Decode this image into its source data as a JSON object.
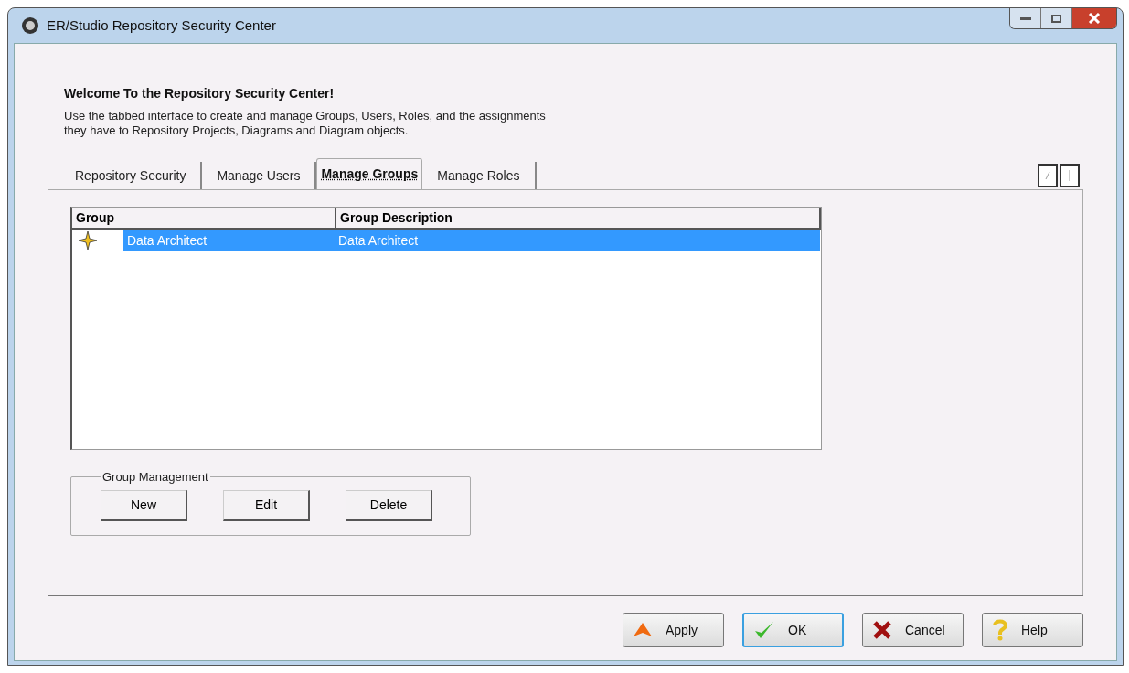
{
  "window": {
    "title": "ER/Studio Repository Security Center"
  },
  "welcome": {
    "heading": "Welcome To the Repository Security Center!",
    "text": "Use the tabbed interface to create and manage Groups, Users, Roles, and the assignments\nthey have to Repository Projects, Diagrams and Diagram objects."
  },
  "tabs": [
    {
      "label": "Repository Security",
      "selected": false
    },
    {
      "label": "Manage Users",
      "selected": false
    },
    {
      "label": "Manage Groups",
      "selected": true
    },
    {
      "label": "Manage Roles",
      "selected": false
    }
  ],
  "table": {
    "columns": [
      "Group",
      "Group Description"
    ],
    "rows": [
      {
        "cells": [
          "Data Architect",
          "Data Architect"
        ],
        "selected": true
      }
    ]
  },
  "group_management": {
    "title": "Group Management",
    "buttons": [
      "New",
      "Edit",
      "Delete"
    ]
  },
  "footer_buttons": [
    {
      "label": "Apply",
      "kind": "apply",
      "default": false
    },
    {
      "label": "OK",
      "kind": "ok",
      "default": true
    },
    {
      "label": "Cancel",
      "kind": "cancel",
      "default": false
    },
    {
      "label": "Help",
      "kind": "help",
      "default": false
    }
  ]
}
